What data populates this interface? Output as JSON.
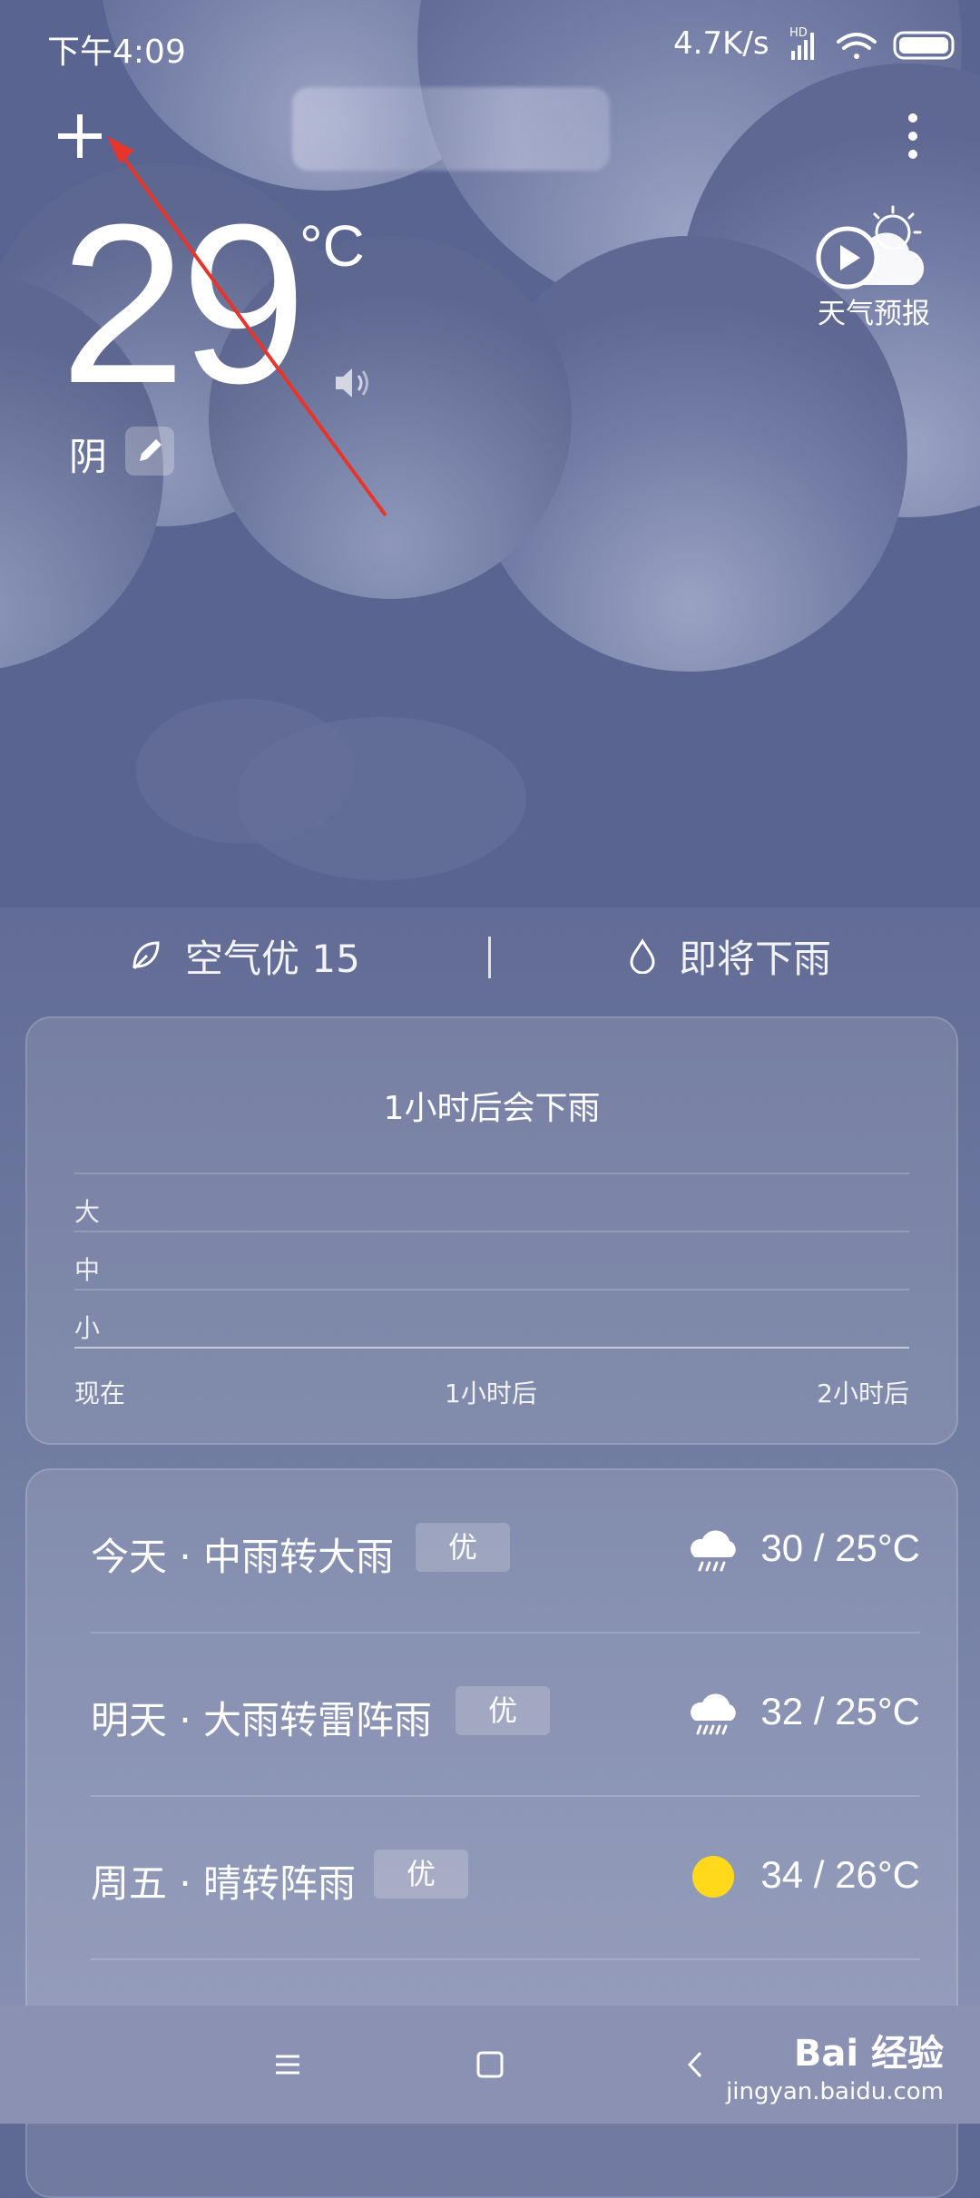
{
  "status_bar": {
    "time": "下午4:09",
    "network_speed": "4.7K/s",
    "hd_label": "HD"
  },
  "header": {
    "add_icon": "plus-icon",
    "menu_icon": "more-vertical-icon",
    "forecast_label": "天气预报"
  },
  "current": {
    "temperature": "29",
    "unit": "°C",
    "condition": "阴"
  },
  "summary": {
    "air": "空气优 15",
    "rain": "即将下雨"
  },
  "rain_card": {
    "title": "1小时后会下雨",
    "levels": [
      "大",
      "中",
      "小"
    ],
    "x_labels": [
      "现在",
      "1小时后",
      "2小时后"
    ]
  },
  "daily": [
    {
      "label": "今天 · 中雨转大雨",
      "aqi": "优",
      "icon": "rain-cloud-icon",
      "temp": "30 / 25°C"
    },
    {
      "label": "明天 · 大雨转雷阵雨",
      "aqi": "优",
      "icon": "rain-cloud-icon",
      "temp": "32 / 25°C"
    },
    {
      "label": "周五 · 晴转阵雨",
      "aqi": "优",
      "icon": "sun-icon",
      "temp": "34 / 26°C"
    }
  ],
  "colors": {
    "sun": "#ffd91a",
    "annotation_arrow": "#e8352b"
  },
  "watermark": {
    "brand": "Bai 经验",
    "url": "jingyan.baidu.com"
  }
}
